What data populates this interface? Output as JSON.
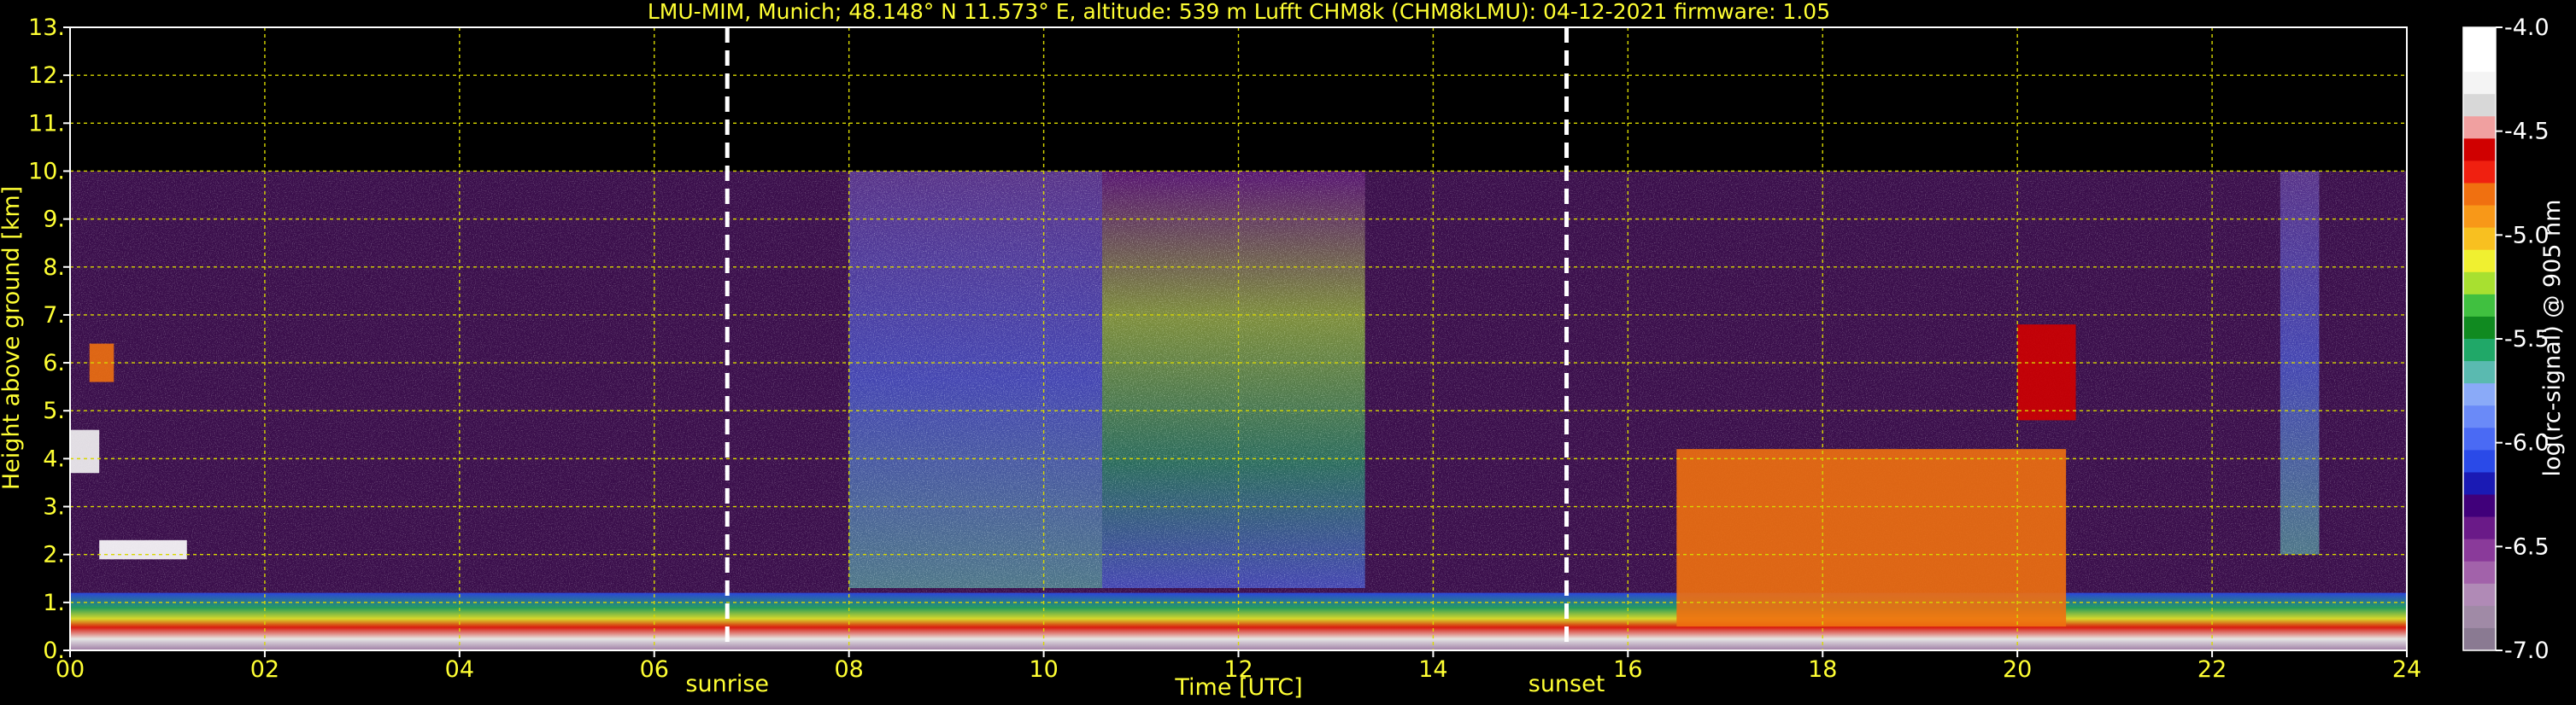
{
  "chart_data": {
    "type": "heatmap",
    "title": "LMU-MIM, Munich; 48.148° N 11.573° E, altitude: 539 m    Lufft CHM8k (CHM8kLMU): 04-12-2021    firmware: 1.05",
    "xlabel": "Time [UTC]",
    "ylabel": "Height above ground [km]",
    "xlim": [
      0,
      24
    ],
    "ylim": [
      0,
      13
    ],
    "x_ticks": [
      "00",
      "02",
      "04",
      "06",
      "08",
      "10",
      "12",
      "14",
      "16",
      "18",
      "20",
      "22",
      "24"
    ],
    "y_ticks": [
      "0.",
      "1.",
      "2.",
      "3.",
      "4.",
      "5.",
      "6.",
      "7.",
      "8.",
      "9.",
      "10.",
      "11.",
      "12.",
      "13."
    ],
    "grid": true,
    "grid_color": "#d8d800",
    "text_color": "#ffff33",
    "measurement_top_km": 10,
    "events": [
      {
        "label": "sunrise",
        "hour": 6.75
      },
      {
        "label": "sunset",
        "hour": 15.37
      }
    ],
    "colorbar": {
      "label": "log(rc-signal) @ 905 nm",
      "range": [
        -7.0,
        -4.0
      ],
      "ticks": [
        "-4.0",
        "-4.5",
        "-5.0",
        "-5.5",
        "-6.0",
        "-6.5",
        "-7.0"
      ],
      "colors": [
        "#8a7a92",
        "#a08aa6",
        "#b08ab6",
        "#a262aa",
        "#8a3a9a",
        "#6a1a88",
        "#40007a",
        "#1a1ab4",
        "#2a4ae8",
        "#4a6af4",
        "#6a8af8",
        "#8aaaf8",
        "#5abab0",
        "#20a868",
        "#108a20",
        "#40c040",
        "#a8e030",
        "#f0f030",
        "#f8c020",
        "#f89818",
        "#f07010",
        "#f02010",
        "#d00000",
        "#f0a0a0",
        "#d8d8d8",
        "#f4f4f4",
        "#ffffff",
        "#ffffff"
      ]
    },
    "layers": [
      {
        "feature": "low-signal background",
        "x": [
          0,
          24
        ],
        "y": [
          0.9,
          10.0
        ],
        "level": -6.4
      },
      {
        "feature": "enhanced signal column",
        "x": [
          10.6,
          13.3
        ],
        "y": [
          1.3,
          10.0
        ],
        "level": -5.3
      },
      {
        "feature": "enhanced signal column",
        "x": [
          8.0,
          10.6
        ],
        "y": [
          1.3,
          10.0
        ],
        "level": -5.9
      },
      {
        "feature": "enhanced signal column",
        "x": [
          22.7,
          23.1
        ],
        "y": [
          2.0,
          10.0
        ],
        "level": -5.9
      },
      {
        "feature": "boundary layer",
        "x": [
          0,
          24
        ],
        "y": [
          0.0,
          1.2
        ],
        "level": -4.5
      },
      {
        "feature": "elevated aerosol layer",
        "x": [
          0.3,
          1.2
        ],
        "y": [
          1.9,
          2.3
        ],
        "level": -4.1
      },
      {
        "feature": "cloud",
        "x": [
          0.0,
          0.3
        ],
        "y": [
          3.7,
          4.6
        ],
        "level": -4.3
      },
      {
        "feature": "cloud",
        "x": [
          0.2,
          0.45
        ],
        "y": [
          5.6,
          6.4
        ],
        "level": -4.8
      },
      {
        "feature": "cloud",
        "x": [
          20.0,
          20.6
        ],
        "y": [
          4.8,
          6.8
        ],
        "level": -4.6
      },
      {
        "feature": "cloud",
        "x": [
          16.5,
          20.5
        ],
        "y": [
          0.5,
          4.2
        ],
        "level": -4.8
      }
    ]
  }
}
